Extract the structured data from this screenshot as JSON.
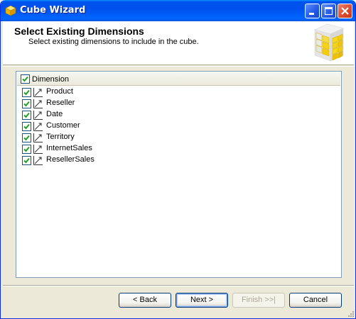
{
  "window": {
    "title": "Cube Wizard"
  },
  "header": {
    "title": "Select Existing Dimensions",
    "subtitle": "Select existing dimensions to include in the cube."
  },
  "list": {
    "header_label": "Dimension",
    "header_checked": true,
    "items": [
      {
        "label": "Product",
        "checked": true,
        "icon": "dimension-icon"
      },
      {
        "label": "Reseller",
        "checked": true,
        "icon": "dimension-icon"
      },
      {
        "label": "Date",
        "checked": true,
        "icon": "dimension-icon"
      },
      {
        "label": "Customer",
        "checked": true,
        "icon": "dimension-icon"
      },
      {
        "label": "Territory",
        "checked": true,
        "icon": "dimension-icon"
      },
      {
        "label": "InternetSales",
        "checked": true,
        "icon": "dimension-icon"
      },
      {
        "label": "ResellerSales",
        "checked": true,
        "icon": "dimension-icon"
      }
    ]
  },
  "buttons": {
    "back": "< Back",
    "next": "Next >",
    "finish": "Finish >>|",
    "cancel": "Cancel"
  },
  "colors": {
    "titlebar": "#0054e3",
    "dialog_bg": "#ece9d8",
    "checkmark": "#21a121",
    "cube_yellow": "#f5d31a"
  }
}
